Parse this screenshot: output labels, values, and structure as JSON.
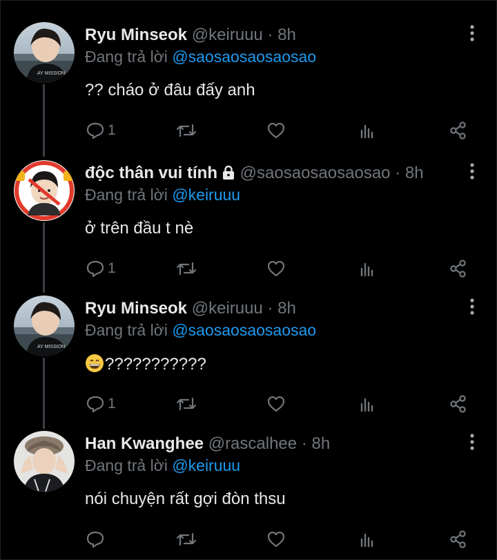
{
  "reply_prefix": "Đang trả lời",
  "tweets": [
    {
      "name": "Ryu Minseok",
      "handle": "@keiruuu",
      "time": "8h",
      "reply_to": "@saosaosaosaosao",
      "text": "?? cháo ở đâu đấy anh",
      "reply_count": "1",
      "locked": false,
      "emoji": ""
    },
    {
      "name": "độc thân vui tính",
      "handle": "@saosaosaosaosao",
      "time": "8h",
      "reply_to": "@keiruuu",
      "text": "ở trên đầu t nè",
      "reply_count": "1",
      "locked": true,
      "emoji": ""
    },
    {
      "name": "Ryu Minseok",
      "handle": "@keiruuu",
      "time": "8h",
      "reply_to": "@saosaosaosaosao",
      "text": "???????????",
      "reply_count": "1",
      "locked": false,
      "emoji": "grinning-face"
    },
    {
      "name": "Han Kwanghee",
      "handle": "@rascalhee",
      "time": "8h",
      "reply_to": "@keiruuu",
      "text": "nói chuyện rất gợi đòn thsu",
      "reply_count": "",
      "locked": false,
      "emoji": ""
    }
  ],
  "colors": {
    "background": "#000000",
    "text": "#e7e9ea",
    "muted": "#71767b",
    "link": "#1d9bf0",
    "thread_line": "#3b3f44"
  },
  "icons": [
    "more-vert-icon",
    "reply-icon",
    "retweet-icon",
    "like-icon",
    "views-icon",
    "share-icon",
    "lock-icon"
  ]
}
